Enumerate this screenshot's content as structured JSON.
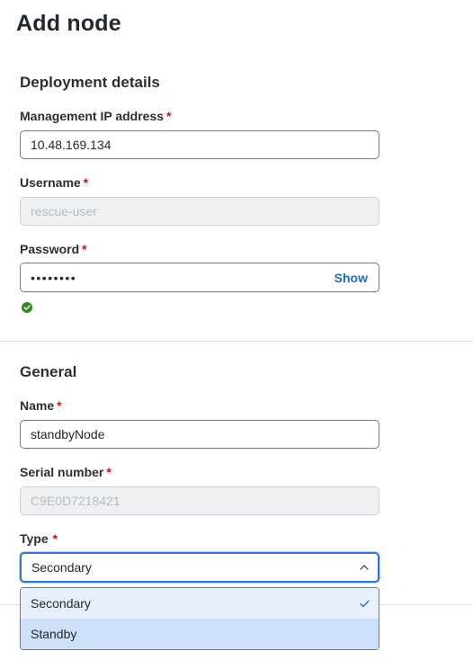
{
  "page": {
    "title": "Add node"
  },
  "deployment": {
    "title": "Deployment details",
    "management_ip": {
      "label": "Management IP address",
      "required": "*",
      "value": "10.48.169.134"
    },
    "username": {
      "label": "Username",
      "required": "*",
      "placeholder": "rescue-user"
    },
    "password": {
      "label": "Password",
      "required": "*",
      "masked_value": "••••••••",
      "show_label": "Show",
      "status": "valid"
    }
  },
  "general": {
    "title": "General",
    "name": {
      "label": "Name",
      "required": "*",
      "value": "standbyNode"
    },
    "serial_number": {
      "label": "Serial number",
      "required": "*",
      "placeholder": "C9E0D7218421"
    },
    "type": {
      "label": "Type",
      "required": "*",
      "value": "Secondary",
      "expanded": true,
      "options": [
        {
          "label": "Secondary",
          "selected": true
        },
        {
          "label": "Standby",
          "selected": false
        }
      ]
    }
  },
  "colors": {
    "accent": "#1d69cc",
    "required": "#c4151c",
    "success": "#2f8a22",
    "focus": "#2f77d0"
  },
  "icons": {
    "password_status": "check-circle-icon",
    "select_toggle": "chevron-up-icon",
    "selected_option": "checkmark-icon"
  }
}
